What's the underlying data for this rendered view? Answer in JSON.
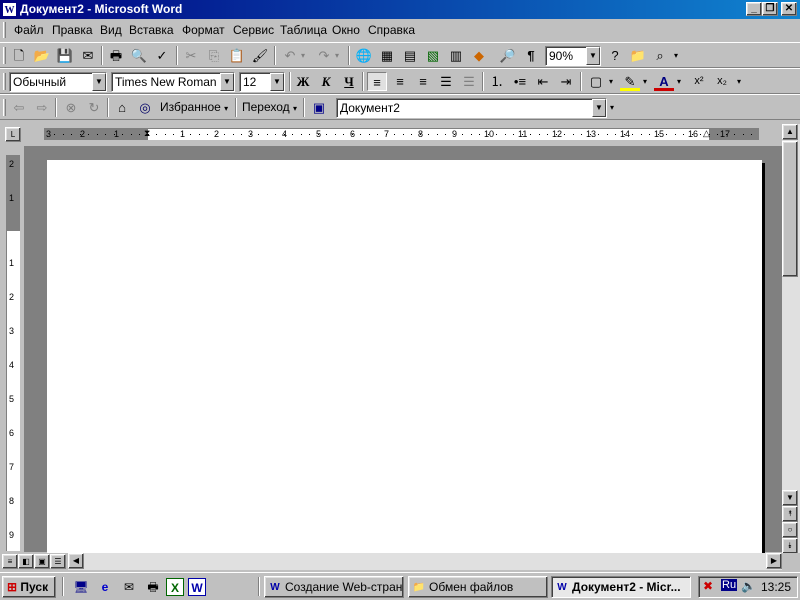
{
  "window": {
    "title": "Документ2 - Microsoft Word",
    "app_icon": "W"
  },
  "menu": [
    "Файл",
    "Правка",
    "Вид",
    "Вставка",
    "Формат",
    "Сервис",
    "Таблица",
    "Окно",
    "Справка"
  ],
  "standard_toolbar": {
    "zoom": "90%"
  },
  "formatting_toolbar": {
    "style": "Обычный",
    "font": "Times New Roman",
    "size": "12",
    "bold": "Ж",
    "italic": "К",
    "underline": "Ч"
  },
  "web_toolbar": {
    "favorites": "Избранное",
    "goto": "Переход",
    "address": "Документ2"
  },
  "ruler": {
    "h_left_numbers": [
      "3",
      "2",
      "1"
    ],
    "h_numbers": [
      "1",
      "2",
      "3",
      "4",
      "5",
      "6",
      "7",
      "8",
      "9",
      "10",
      "11",
      "12",
      "13",
      "14",
      "15",
      "16",
      "17"
    ],
    "v_top_numbers": [
      "2",
      "1"
    ],
    "v_numbers": [
      "1",
      "2",
      "3",
      "4",
      "5",
      "6",
      "7",
      "8",
      "9"
    ]
  },
  "taskbar": {
    "start": "Пуск",
    "tasks": [
      {
        "label": "Создание Web-стран...",
        "icon": "word-doc-icon"
      },
      {
        "label": "Обмен файлов",
        "icon": "folder-icon"
      },
      {
        "label": "Документ2 - Micr...",
        "icon": "word-doc-icon",
        "active": true
      }
    ],
    "lang": "Ru",
    "time": "13:25"
  }
}
